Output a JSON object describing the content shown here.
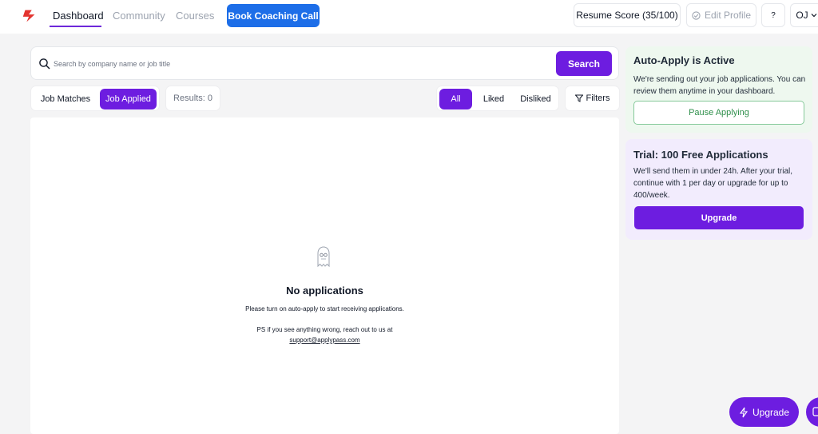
{
  "nav": {
    "dashboard": "Dashboard",
    "community": "Community",
    "courses": "Courses",
    "coaching": "Book Coaching Call",
    "resume_score": "Resume Score (35/100)",
    "edit_profile": "Edit Profile",
    "help": "?",
    "user_initials": "OJ"
  },
  "search": {
    "placeholder": "Search by company name or job title",
    "button": "Search"
  },
  "tabs": {
    "job_matches": "Job Matches",
    "job_applied": "Job Applied"
  },
  "results": "Results: 0",
  "filters": {
    "all": "All",
    "liked": "Liked",
    "disliked": "Disliked",
    "filters": "Filters"
  },
  "empty": {
    "title": "No applications",
    "text": "Please turn on auto-apply to start receiving applications.",
    "ps": "PS if you see anything wrong, reach out to us at",
    "email": "support@applypass.com"
  },
  "auto_apply": {
    "title": "Auto-Apply is Active",
    "text": "We're sending out your job applications. You can review them anytime in your dashboard.",
    "button": "Pause Applying"
  },
  "trial": {
    "title": "Trial: 100 Free Applications",
    "text": "We'll send them in under 24h. After your trial, continue with 1 per day or upgrade for up to 400/week.",
    "button": "Upgrade"
  },
  "fab": {
    "upgrade": "Upgrade"
  },
  "colors": {
    "accent": "#6d1de0",
    "coaching": "#1d6ee8",
    "logo": "#e3342f"
  },
  "icons": [
    "logo-icon",
    "search-icon",
    "filter-icon",
    "check-circle-icon",
    "chevron-down-icon",
    "ghost-icon",
    "lightning-icon",
    "chat-icon"
  ]
}
